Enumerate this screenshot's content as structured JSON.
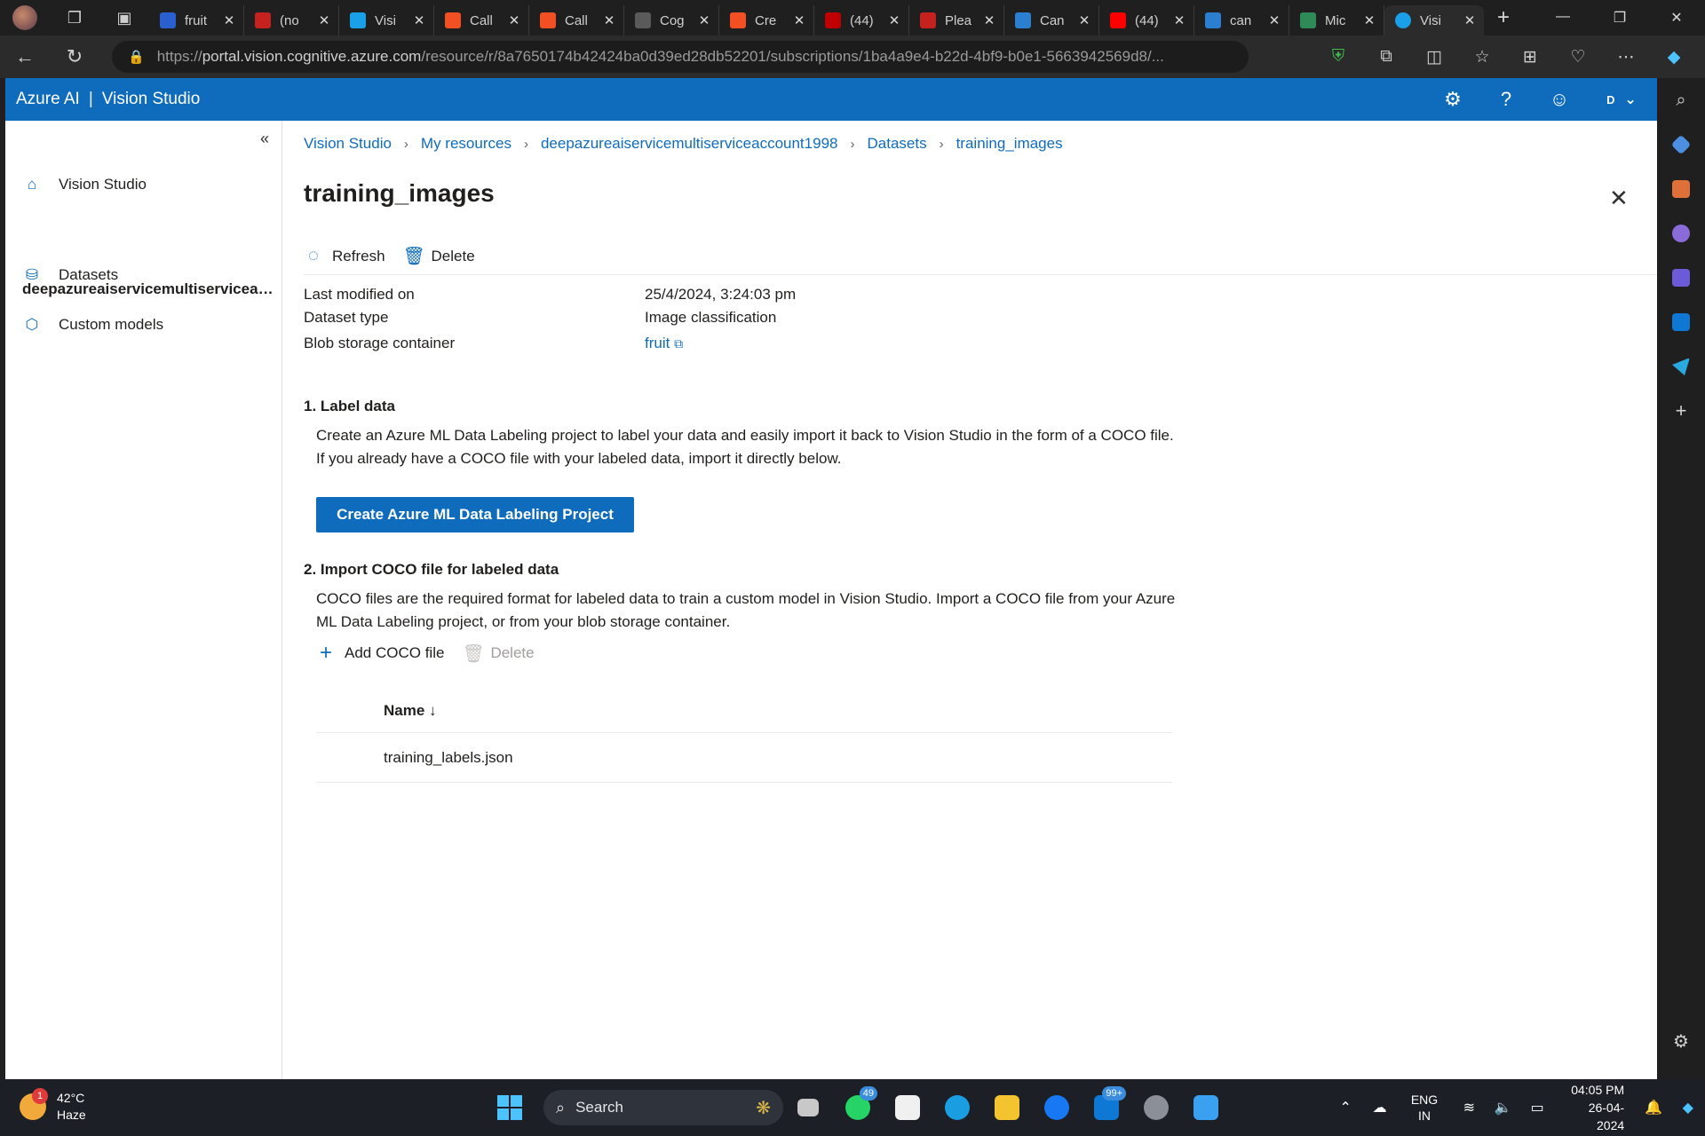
{
  "browser": {
    "tabs": [
      {
        "title": "fruit",
        "color": "#2a5fd0"
      },
      {
        "title": "(no",
        "color": "#c5221f"
      },
      {
        "title": "Visi",
        "color": "#1aa0e8"
      },
      {
        "title": "Call",
        "color": "#f25022"
      },
      {
        "title": "Call",
        "color": "#f25022"
      },
      {
        "title": "Cog",
        "color": "#5a5a5a"
      },
      {
        "title": "Cre",
        "color": "#f25022"
      },
      {
        "title": "(44)",
        "color": "#c00000"
      },
      {
        "title": "Plea",
        "color": "#c5221f"
      },
      {
        "title": "Can",
        "color": "#2a7fd0"
      },
      {
        "title": "(44)",
        "color": "#ff0000"
      },
      {
        "title": "can",
        "color": "#2a7fd0"
      },
      {
        "title": "Mic",
        "color": "#2e8b57"
      }
    ],
    "active_tab": {
      "title": "Visi",
      "color": "#1aa0e8"
    },
    "url_prefix": "https://",
    "url_host": "portal.vision.cognitive.azure.com",
    "url_path": "/resource/r/8a7650174b42424ba0d39ed28db52201/subscriptions/1ba4a9e4-b22d-4bf9-b0e1-5663942569d8/..."
  },
  "app": {
    "brand": "Azure AI",
    "product": "Vision Studio",
    "user_initial": "D"
  },
  "sidebar": {
    "home": "Vision Studio",
    "resource": "deepazureaiservicemultiserviceaccount1998",
    "datasets": "Datasets",
    "custom_models": "Custom models"
  },
  "breadcrumb": [
    "Vision Studio",
    "My resources",
    "deepazureaiservicemultiserviceaccount1998",
    "Datasets",
    "training_images"
  ],
  "page": {
    "title": "training_images",
    "refresh": "Refresh",
    "delete": "Delete"
  },
  "properties": [
    {
      "key": "Last modified on",
      "value": "25/4/2024, 3:24:03 pm"
    },
    {
      "key": "Dataset type",
      "value": "Image classification"
    },
    {
      "key": "Blob storage container",
      "value": "fruit"
    }
  ],
  "label_section": {
    "title": "1. Label data",
    "text": "Create an Azure ML Data Labeling project to label your data and easily import it back to Vision Studio in the form of a COCO file. If you already have a COCO file with your labeled data, import it directly below.",
    "button": "Create Azure ML Data Labeling Project"
  },
  "import_section": {
    "title": "2. Import COCO file for labeled data",
    "text": "COCO files are the required format for labeled data to train a custom model in Vision Studio. Import a COCO file from your Azure ML Data Labeling project, or from your blob storage container.",
    "add": "Add COCO file",
    "delete": "Delete",
    "column_name": "Name ↓",
    "rows": [
      "training_labels.json"
    ]
  },
  "taskbar": {
    "temp": "42°C",
    "weather": "Haze",
    "weather_badge": "1",
    "search": "Search",
    "whatsapp_badge": "49",
    "mail_badge": "99+",
    "lang1": "ENG",
    "lang2": "IN",
    "time": "04:05 PM",
    "date": "26-04-2024"
  },
  "colors": {
    "accent": "#0f6cbd"
  }
}
